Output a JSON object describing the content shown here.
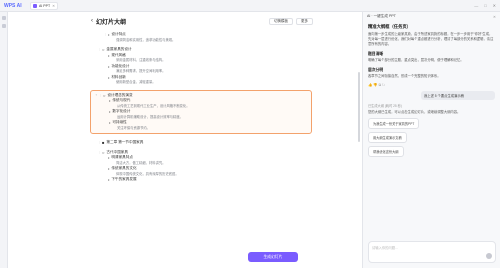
{
  "app": {
    "logo": "WPS AI",
    "tab_label": "AI PPT",
    "win_min": "—",
    "win_max": "□",
    "win_close": "✕"
  },
  "editor": {
    "back": "‹",
    "title": "幻灯片大纲",
    "btn_switch": "切换模板",
    "btn_more": "更多",
    "generate": "生成幻灯片",
    "blocks": [
      {
        "num": "",
        "items": [
          {
            "lv": 2,
            "bul": "•",
            "text": "设计特点",
            "sub": false
          },
          {
            "lv": 3,
            "bul": "",
            "text": "强调简洁和实用性，追求功能性与美观。",
            "sub": true
          }
        ]
      },
      {
        "num": "",
        "items": [
          {
            "lv": 1,
            "bul": "○",
            "text": "金属家具的设计",
            "sub": false
          },
          {
            "lv": 2,
            "bul": "•",
            "text": "现代风格",
            "sub": false
          },
          {
            "lv": 3,
            "bul": "",
            "text": "采用金属材料，注重线条与结构。",
            "sub": true
          },
          {
            "lv": 2,
            "bul": "•",
            "text": "功能化设计",
            "sub": false
          },
          {
            "lv": 3,
            "bul": "",
            "text": "满足多种需求，提升空间利用率。",
            "sub": true
          },
          {
            "lv": 2,
            "bul": "•",
            "text": "材料创新",
            "sub": false
          },
          {
            "lv": 3,
            "bul": "",
            "text": "使用新型合金，减轻重量。",
            "sub": true
          }
        ]
      }
    ],
    "selected": {
      "num": "7",
      "items": [
        {
          "lv": 1,
          "bul": "○",
          "text": "设计理念的演变",
          "sub": false
        },
        {
          "lv": 2,
          "bul": "•",
          "text": "传统与现代",
          "sub": false
        },
        {
          "lv": 3,
          "bul": "",
          "text": "从传统工艺到现代工业生产，设计风格不断变化。",
          "sub": true
        },
        {
          "lv": 2,
          "bul": "•",
          "text": "数字化设计",
          "sub": false
        },
        {
          "lv": 3,
          "bul": "",
          "text": "运用计算机辅助设计，提高设计效率与精度。",
          "sub": true
        },
        {
          "lv": 2,
          "bul": "•",
          "text": "可持续性",
          "sub": false
        },
        {
          "lv": 3,
          "bul": "",
          "text": "关注环保与资源节约。",
          "sub": true
        }
      ]
    },
    "after": [
      {
        "num": "",
        "items": [
          {
            "lv": 1,
            "bul": "■",
            "text": "第二章 第一节中国家具",
            "sub": false
          }
        ]
      },
      {
        "num": "",
        "items": [
          {
            "lv": 1,
            "bul": "○",
            "text": "古代中国家具",
            "sub": false
          },
          {
            "lv": 2,
            "bul": "•",
            "text": "明清家具特点",
            "sub": false
          },
          {
            "lv": 3,
            "bul": "",
            "text": "简洁大方，做工精细，材料讲究。",
            "sub": true
          },
          {
            "lv": 2,
            "bul": "•",
            "text": "传统家具的文化",
            "sub": false
          },
          {
            "lv": 3,
            "bul": "",
            "text": "体现中国传统文化，具有深厚的历史底蕴。",
            "sub": true
          },
          {
            "lv": 2,
            "bul": "•",
            "text": "下午的家具发展",
            "sub": false
          }
        ]
      }
    ]
  },
  "chat": {
    "head": "AI · 一键生成 PPT",
    "title": "精准大纲框（任务页）",
    "p1": "面向第一步生成的上级家具篇，由于所述家具篇的标题，在一步一步用于\"你好\"生成，先对每一层进行优化，我们对每个重点都进行分析，理清了每部分的关系和逻辑，请注意所有的内容。",
    "h1": "题目清晰",
    "p2": "明确了每个部分的主题，重点突出，层次分明，便于理解和记忆。",
    "h2": "层次分明",
    "p3": "各章节之间衔接自然，形成一个完整的知识体系。",
    "acts": "👍 👎 ⧉ ↻",
    "user": "我上述 5 个要点生成演示稿",
    "meta": "已生成大纲 (耗时 25 秒)",
    "p4": "您的大纲已生成，可以点击生成幻灯片，或继续调整大纲内容。",
    "sugg1": "为我生成一份关于家具的PPT",
    "sugg2": "用大纲生成演示文稿",
    "sugg3": "帮我优化这份大纲",
    "placeholder": "请输入你的问题..."
  }
}
